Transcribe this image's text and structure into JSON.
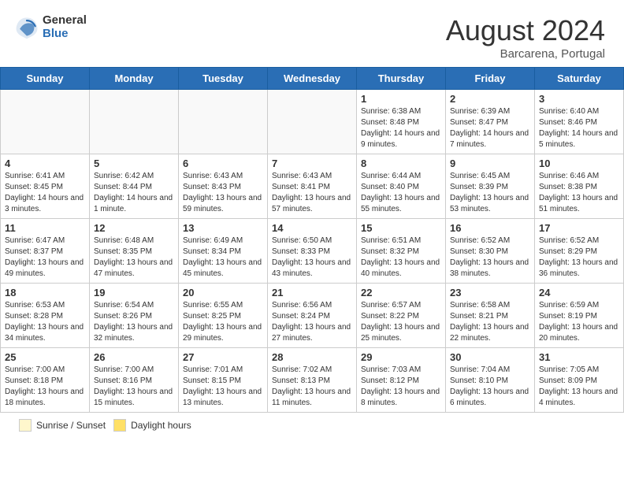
{
  "header": {
    "logo_general": "General",
    "logo_blue": "Blue",
    "month_year": "August 2024",
    "location": "Barcarena, Portugal"
  },
  "weekdays": [
    "Sunday",
    "Monday",
    "Tuesday",
    "Wednesday",
    "Thursday",
    "Friday",
    "Saturday"
  ],
  "weeks": [
    [
      {
        "day": "",
        "info": ""
      },
      {
        "day": "",
        "info": ""
      },
      {
        "day": "",
        "info": ""
      },
      {
        "day": "",
        "info": ""
      },
      {
        "day": "1",
        "info": "Sunrise: 6:38 AM\nSunset: 8:48 PM\nDaylight: 14 hours\nand 9 minutes."
      },
      {
        "day": "2",
        "info": "Sunrise: 6:39 AM\nSunset: 8:47 PM\nDaylight: 14 hours\nand 7 minutes."
      },
      {
        "day": "3",
        "info": "Sunrise: 6:40 AM\nSunset: 8:46 PM\nDaylight: 14 hours\nand 5 minutes."
      }
    ],
    [
      {
        "day": "4",
        "info": "Sunrise: 6:41 AM\nSunset: 8:45 PM\nDaylight: 14 hours\nand 3 minutes."
      },
      {
        "day": "5",
        "info": "Sunrise: 6:42 AM\nSunset: 8:44 PM\nDaylight: 14 hours\nand 1 minute."
      },
      {
        "day": "6",
        "info": "Sunrise: 6:43 AM\nSunset: 8:43 PM\nDaylight: 13 hours\nand 59 minutes."
      },
      {
        "day": "7",
        "info": "Sunrise: 6:43 AM\nSunset: 8:41 PM\nDaylight: 13 hours\nand 57 minutes."
      },
      {
        "day": "8",
        "info": "Sunrise: 6:44 AM\nSunset: 8:40 PM\nDaylight: 13 hours\nand 55 minutes."
      },
      {
        "day": "9",
        "info": "Sunrise: 6:45 AM\nSunset: 8:39 PM\nDaylight: 13 hours\nand 53 minutes."
      },
      {
        "day": "10",
        "info": "Sunrise: 6:46 AM\nSunset: 8:38 PM\nDaylight: 13 hours\nand 51 minutes."
      }
    ],
    [
      {
        "day": "11",
        "info": "Sunrise: 6:47 AM\nSunset: 8:37 PM\nDaylight: 13 hours\nand 49 minutes."
      },
      {
        "day": "12",
        "info": "Sunrise: 6:48 AM\nSunset: 8:35 PM\nDaylight: 13 hours\nand 47 minutes."
      },
      {
        "day": "13",
        "info": "Sunrise: 6:49 AM\nSunset: 8:34 PM\nDaylight: 13 hours\nand 45 minutes."
      },
      {
        "day": "14",
        "info": "Sunrise: 6:50 AM\nSunset: 8:33 PM\nDaylight: 13 hours\nand 43 minutes."
      },
      {
        "day": "15",
        "info": "Sunrise: 6:51 AM\nSunset: 8:32 PM\nDaylight: 13 hours\nand 40 minutes."
      },
      {
        "day": "16",
        "info": "Sunrise: 6:52 AM\nSunset: 8:30 PM\nDaylight: 13 hours\nand 38 minutes."
      },
      {
        "day": "17",
        "info": "Sunrise: 6:52 AM\nSunset: 8:29 PM\nDaylight: 13 hours\nand 36 minutes."
      }
    ],
    [
      {
        "day": "18",
        "info": "Sunrise: 6:53 AM\nSunset: 8:28 PM\nDaylight: 13 hours\nand 34 minutes."
      },
      {
        "day": "19",
        "info": "Sunrise: 6:54 AM\nSunset: 8:26 PM\nDaylight: 13 hours\nand 32 minutes."
      },
      {
        "day": "20",
        "info": "Sunrise: 6:55 AM\nSunset: 8:25 PM\nDaylight: 13 hours\nand 29 minutes."
      },
      {
        "day": "21",
        "info": "Sunrise: 6:56 AM\nSunset: 8:24 PM\nDaylight: 13 hours\nand 27 minutes."
      },
      {
        "day": "22",
        "info": "Sunrise: 6:57 AM\nSunset: 8:22 PM\nDaylight: 13 hours\nand 25 minutes."
      },
      {
        "day": "23",
        "info": "Sunrise: 6:58 AM\nSunset: 8:21 PM\nDaylight: 13 hours\nand 22 minutes."
      },
      {
        "day": "24",
        "info": "Sunrise: 6:59 AM\nSunset: 8:19 PM\nDaylight: 13 hours\nand 20 minutes."
      }
    ],
    [
      {
        "day": "25",
        "info": "Sunrise: 7:00 AM\nSunset: 8:18 PM\nDaylight: 13 hours\nand 18 minutes."
      },
      {
        "day": "26",
        "info": "Sunrise: 7:00 AM\nSunset: 8:16 PM\nDaylight: 13 hours\nand 15 minutes."
      },
      {
        "day": "27",
        "info": "Sunrise: 7:01 AM\nSunset: 8:15 PM\nDaylight: 13 hours\nand 13 minutes."
      },
      {
        "day": "28",
        "info": "Sunrise: 7:02 AM\nSunset: 8:13 PM\nDaylight: 13 hours\nand 11 minutes."
      },
      {
        "day": "29",
        "info": "Sunrise: 7:03 AM\nSunset: 8:12 PM\nDaylight: 13 hours\nand 8 minutes."
      },
      {
        "day": "30",
        "info": "Sunrise: 7:04 AM\nSunset: 8:10 PM\nDaylight: 13 hours\nand 6 minutes."
      },
      {
        "day": "31",
        "info": "Sunrise: 7:05 AM\nSunset: 8:09 PM\nDaylight: 13 hours\nand 4 minutes."
      }
    ]
  ],
  "footer": {
    "sunrise_label": "Sunrise / Sunset",
    "daylight_label": "Daylight hours"
  }
}
